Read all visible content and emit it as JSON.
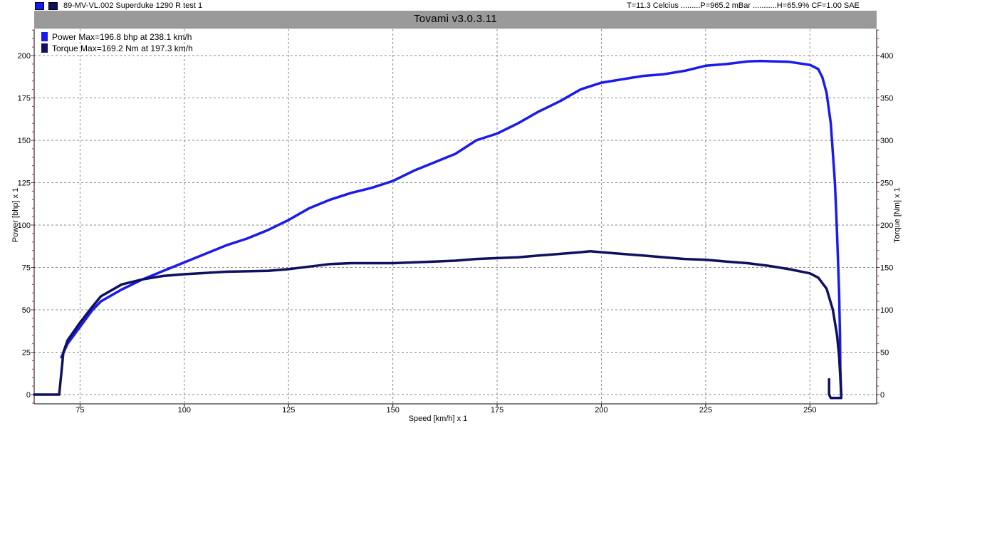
{
  "header": {
    "run_title": "89-MV-VL.002 Superduke 1290 R   test 1",
    "conditions": "T=11.3 Celcius .........P=965.2 mBar ...........H=65.9% CF=1.00 SAE",
    "app_title": "Tovami  v3.0.3.11",
    "swatch_colors": [
      "#1a1aee",
      "#101060"
    ]
  },
  "chart_data": {
    "type": "line",
    "xlabel": "Speed [km/h] x 1",
    "ylabel_left": "Power [bhp] x 1",
    "ylabel_right": "Torque [Nm] x 1",
    "xlim": [
      64,
      266
    ],
    "ylim_left": [
      0,
      200
    ],
    "ylim_right": [
      0,
      400
    ],
    "x_ticks": [
      75,
      100,
      125,
      150,
      175,
      200,
      225,
      250
    ],
    "y_ticks_left": [
      0,
      25,
      50,
      75,
      100,
      125,
      150,
      175,
      200
    ],
    "y_ticks_right": [
      0,
      50,
      100,
      150,
      200,
      250,
      300,
      350,
      400
    ],
    "grid": true,
    "legend_position": "top-left",
    "series": [
      {
        "name": "Power",
        "legend": "Power  Max=196.8 bhp at 238.1 km/h",
        "axis": "left",
        "color": "#1a1aee",
        "points": [
          [
            70.5,
            22
          ],
          [
            72,
            30
          ],
          [
            75,
            40
          ],
          [
            78,
            50
          ],
          [
            80,
            55
          ],
          [
            85,
            62
          ],
          [
            90,
            68
          ],
          [
            95,
            73
          ],
          [
            100,
            78
          ],
          [
            105,
            83
          ],
          [
            110,
            88
          ],
          [
            115,
            92
          ],
          [
            120,
            97
          ],
          [
            125,
            103
          ],
          [
            130,
            110
          ],
          [
            135,
            115
          ],
          [
            140,
            119
          ],
          [
            145,
            122
          ],
          [
            150,
            126
          ],
          [
            155,
            132
          ],
          [
            160,
            137
          ],
          [
            165,
            142
          ],
          [
            170,
            150
          ],
          [
            175,
            154
          ],
          [
            180,
            160
          ],
          [
            185,
            167
          ],
          [
            190,
            173
          ],
          [
            195,
            180
          ],
          [
            200,
            184
          ],
          [
            205,
            186
          ],
          [
            210,
            188
          ],
          [
            215,
            189
          ],
          [
            220,
            191
          ],
          [
            225,
            194
          ],
          [
            230,
            195
          ],
          [
            235,
            196.5
          ],
          [
            238.1,
            196.8
          ],
          [
            245,
            196.3
          ],
          [
            250,
            194.5
          ],
          [
            252,
            192
          ],
          [
            253,
            187
          ],
          [
            254,
            178
          ],
          [
            255,
            160
          ],
          [
            256,
            125
          ],
          [
            256.5,
            95
          ],
          [
            257,
            60
          ],
          [
            257.2,
            35
          ],
          [
            257.3,
            15
          ],
          [
            257.5,
            0
          ]
        ]
      },
      {
        "name": "Torque",
        "legend": "Torque  Max=169.2 Nm at 197.3 km/h",
        "axis": "right",
        "color": "#101060",
        "points": [
          [
            64,
            0
          ],
          [
            70,
            0
          ],
          [
            70.5,
            25
          ],
          [
            71,
            50
          ],
          [
            72,
            64
          ],
          [
            75,
            85
          ],
          [
            78,
            104
          ],
          [
            80,
            116
          ],
          [
            85,
            130
          ],
          [
            90,
            136
          ],
          [
            95,
            140
          ],
          [
            100,
            142
          ],
          [
            110,
            145
          ],
          [
            120,
            146
          ],
          [
            125,
            148
          ],
          [
            130,
            151
          ],
          [
            135,
            154
          ],
          [
            140,
            155
          ],
          [
            145,
            155
          ],
          [
            150,
            155
          ],
          [
            155,
            156
          ],
          [
            160,
            157
          ],
          [
            165,
            158
          ],
          [
            170,
            160
          ],
          [
            175,
            161
          ],
          [
            180,
            162
          ],
          [
            185,
            164
          ],
          [
            190,
            166
          ],
          [
            195,
            168
          ],
          [
            197.3,
            169.2
          ],
          [
            200,
            168
          ],
          [
            205,
            166
          ],
          [
            210,
            164
          ],
          [
            215,
            162
          ],
          [
            220,
            160
          ],
          [
            225,
            159
          ],
          [
            230,
            157
          ],
          [
            235,
            155
          ],
          [
            240,
            152
          ],
          [
            245,
            148
          ],
          [
            250,
            143
          ],
          [
            252,
            138
          ],
          [
            254,
            125
          ],
          [
            255.5,
            100
          ],
          [
            256.5,
            70
          ],
          [
            257,
            45
          ],
          [
            257.3,
            20
          ],
          [
            257.5,
            0
          ],
          [
            257.5,
            -4
          ],
          [
            255,
            -4
          ],
          [
            254.6,
            0
          ],
          [
            254.6,
            18
          ]
        ]
      }
    ]
  }
}
